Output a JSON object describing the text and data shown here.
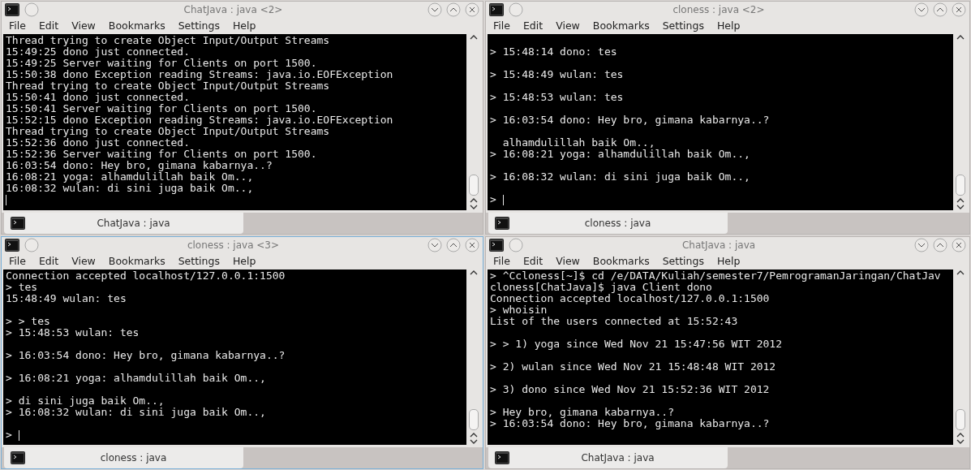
{
  "windows": [
    {
      "title": "ChatJava : java <2>",
      "active": false,
      "menu": [
        "File",
        "Edit",
        "View",
        "Bookmarks",
        "Settings",
        "Help"
      ],
      "lines": [
        {
          "kind": "text",
          "text": "Thread trying to create Object Input/Output Streams"
        },
        {
          "kind": "text",
          "text": "15:49:25 dono just connected."
        },
        {
          "kind": "text",
          "text": "15:49:25 Server waiting for Clients on port 1500."
        },
        {
          "kind": "text",
          "text": "15:50:38 dono Exception reading Streams: java.io.EOFException"
        },
        {
          "kind": "text",
          "text": "Thread trying to create Object Input/Output Streams"
        },
        {
          "kind": "text",
          "text": "15:50:41 dono just connected."
        },
        {
          "kind": "text",
          "text": "15:50:41 Server waiting for Clients on port 1500."
        },
        {
          "kind": "text",
          "text": "15:52:15 dono Exception reading Streams: java.io.EOFException"
        },
        {
          "kind": "text",
          "text": "Thread trying to create Object Input/Output Streams"
        },
        {
          "kind": "text",
          "text": "15:52:36 dono just connected."
        },
        {
          "kind": "text",
          "text": "15:52:36 Server waiting for Clients on port 1500."
        },
        {
          "kind": "text",
          "text": "16:03:54 dono: Hey bro, gimana kabarnya..?"
        },
        {
          "kind": "text",
          "text": "16:08:21 yoga: alhamdulillah baik Om..,"
        },
        {
          "kind": "text",
          "text": "16:08:32 wulan: di sini juga baik Om..,"
        },
        {
          "kind": "cursor"
        }
      ],
      "tab": "ChatJava : java"
    },
    {
      "title": "cloness : java <2>",
      "active": false,
      "menu": [
        "File",
        "Edit",
        "View",
        "Bookmarks",
        "Settings",
        "Help"
      ],
      "lines": [
        {
          "kind": "blank"
        },
        {
          "kind": "text",
          "text": "> 15:48:14 dono: tes"
        },
        {
          "kind": "blank"
        },
        {
          "kind": "text",
          "text": "> 15:48:49 wulan: tes"
        },
        {
          "kind": "blank"
        },
        {
          "kind": "text",
          "text": "> 15:48:53 wulan: tes"
        },
        {
          "kind": "blank"
        },
        {
          "kind": "text",
          "text": "> 16:03:54 dono: Hey bro, gimana kabarnya..?"
        },
        {
          "kind": "blank"
        },
        {
          "kind": "text",
          "text": "  alhamdulillah baik Om..,"
        },
        {
          "kind": "text",
          "text": "> 16:08:21 yoga: alhamdulillah baik Om..,"
        },
        {
          "kind": "blank"
        },
        {
          "kind": "text",
          "text": "> 16:08:32 wulan: di sini juga baik Om..,"
        },
        {
          "kind": "blank"
        },
        {
          "kind": "cursor",
          "prompt": ">"
        }
      ],
      "tab": "cloness : java"
    },
    {
      "title": "cloness : java <3>",
      "active": true,
      "menu": [
        "File",
        "Edit",
        "View",
        "Bookmarks",
        "Settings",
        "Help"
      ],
      "lines": [
        {
          "kind": "text",
          "text": "Connection accepted localhost/127.0.0.1:1500"
        },
        {
          "kind": "text",
          "text": "> tes"
        },
        {
          "kind": "text",
          "text": "15:48:49 wulan: tes"
        },
        {
          "kind": "blank"
        },
        {
          "kind": "text",
          "text": "> > tes"
        },
        {
          "kind": "text",
          "text": "> 15:48:53 wulan: tes"
        },
        {
          "kind": "blank"
        },
        {
          "kind": "text",
          "text": "> 16:03:54 dono: Hey bro, gimana kabarnya..?"
        },
        {
          "kind": "blank"
        },
        {
          "kind": "text",
          "text": "> 16:08:21 yoga: alhamdulillah baik Om..,"
        },
        {
          "kind": "blank"
        },
        {
          "kind": "text",
          "text": "> di sini juga baik Om..,"
        },
        {
          "kind": "text",
          "text": "> 16:08:32 wulan: di sini juga baik Om..,"
        },
        {
          "kind": "blank"
        },
        {
          "kind": "cursor",
          "prompt": ">"
        }
      ],
      "tab": "cloness : java"
    },
    {
      "title": "ChatJava : java",
      "active": false,
      "menu": [
        "File",
        "Edit",
        "View",
        "Bookmarks",
        "Settings",
        "Help"
      ],
      "lines": [
        {
          "kind": "text",
          "text": "> ^Ccloness[~]$ cd /e/DATA/Kuliah/semester7/PemrogramanJaringan/ChatJav"
        },
        {
          "kind": "text",
          "text": "cloness[ChatJava]$ java Client dono"
        },
        {
          "kind": "text",
          "text": "Connection accepted localhost/127.0.0.1:1500"
        },
        {
          "kind": "text",
          "text": "> whoisin"
        },
        {
          "kind": "text",
          "text": "List of the users connected at 15:52:43"
        },
        {
          "kind": "blank"
        },
        {
          "kind": "text",
          "text": "> > 1) yoga since Wed Nov 21 15:47:56 WIT 2012"
        },
        {
          "kind": "blank"
        },
        {
          "kind": "text",
          "text": "> 2) wulan since Wed Nov 21 15:48:48 WIT 2012"
        },
        {
          "kind": "blank"
        },
        {
          "kind": "text",
          "text": "> 3) dono since Wed Nov 21 15:52:36 WIT 2012"
        },
        {
          "kind": "blank"
        },
        {
          "kind": "text",
          "text": "> Hey bro, gimana kabarnya..?"
        },
        {
          "kind": "text",
          "text": "> 16:03:54 dono: Hey bro, gimana kabarnya..?"
        }
      ],
      "tab": "ChatJava : java"
    }
  ]
}
